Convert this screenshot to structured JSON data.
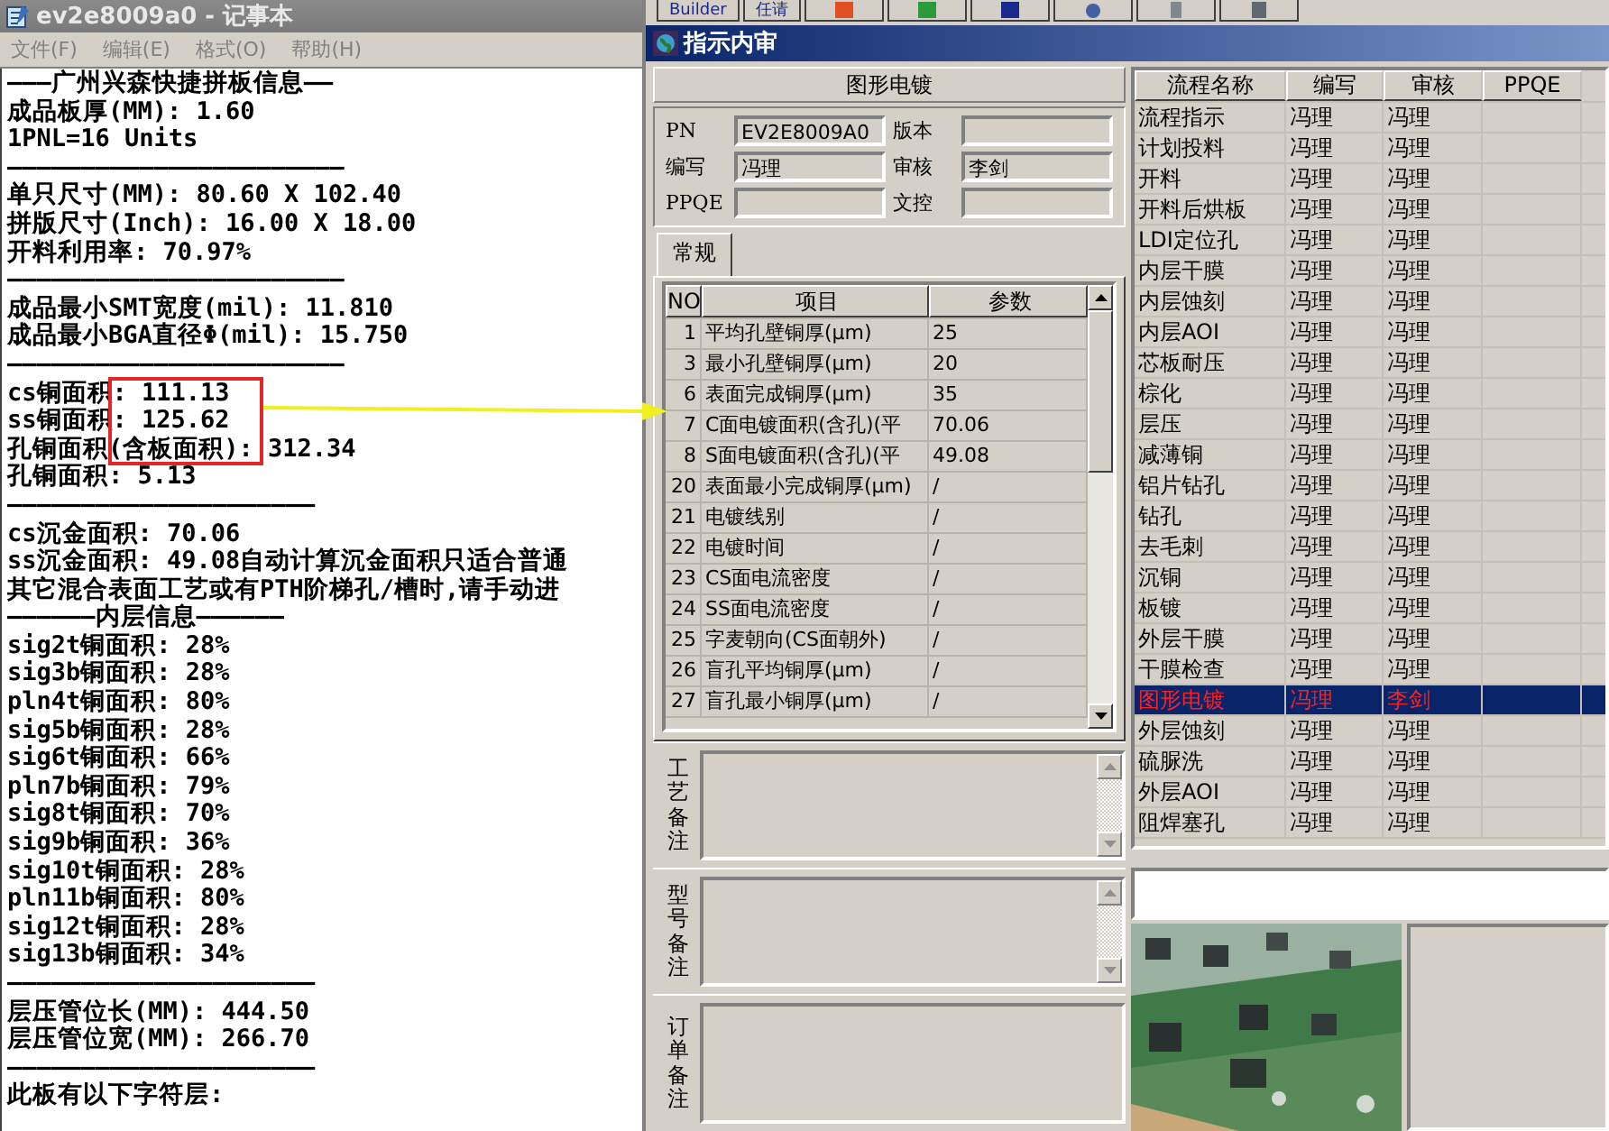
{
  "notepad": {
    "title": "ev2e8009a0 - 记事本",
    "menu": [
      "文件(F)",
      "编辑(E)",
      "格式(O)",
      "帮助(H)"
    ],
    "lines": [
      "———广州兴森快捷拼板信息——",
      "成品板厚(MM): 1.60",
      "1PNL=16 Units",
      "———————————————————————",
      "单只尺寸(MM): 80.60 X 102.40",
      "拼版尺寸(Inch): 16.00 X 18.00",
      "开料利用率: 70.97%",
      "———————————————————————",
      "成品最小SMT宽度(mil): 11.810",
      "成品最小BGA直径Φ(mil):  15.750",
      "———————————————————————",
      "cs铜面积: 111.13",
      "ss铜面积: 125.62",
      "孔铜面积(含板面积): 312.34",
      "孔铜面积: 5.13",
      "—————————————————————",
      "cs沉金面积: 70.06",
      "ss沉金面积: 49.08自动计算沉金面积只适合普通",
      "其它混合表面工艺或有PTH阶梯孔/槽时,请手动进",
      "——————内层信息——————",
      "sig2t铜面积: 28%",
      "sig3b铜面积: 28%",
      "pln4t铜面积: 80%",
      "sig5b铜面积: 28%",
      "sig6t铜面积: 66%",
      "pln7b铜面积: 79%",
      "sig8t铜面积: 70%",
      "sig9b铜面积: 36%",
      "sig10t铜面积: 28%",
      "pln11b铜面积: 80%",
      "sig12t铜面积: 28%",
      "sig13b铜面积: 34%",
      "—————————————————————",
      "层压管位长(MM): 444.50",
      "层压管位宽(MM): 266.70",
      "—————————————————————",
      "此板有以下字符层:"
    ]
  },
  "toolbar": {
    "buttons": [
      "Builder",
      "任请"
    ]
  },
  "window": {
    "title": "指示内审"
  },
  "process_header": "图形电镀",
  "fields": [
    {
      "label": "PN",
      "value": "EV2E8009A0"
    },
    {
      "label": "版本"
    },
    {
      "label": "编写",
      "value": "冯理"
    },
    {
      "label": "审核",
      "value": "李剑"
    },
    {
      "label": "PPQE"
    },
    {
      "label": "文控"
    }
  ],
  "tabs": [
    {
      "label": "常规",
      "selected": true
    }
  ],
  "param_table": {
    "columns": [
      "NO",
      "项目",
      "参数"
    ],
    "rows": [
      [
        "1",
        "平均孔壁铜厚(μm)",
        "25"
      ],
      [
        "3",
        "最小孔壁铜厚(μm)",
        "20"
      ],
      [
        "6",
        "表面完成铜厚(μm)",
        "35"
      ],
      [
        "7",
        "C面电镀面积(含孔)(平",
        "70.06"
      ],
      [
        "8",
        "S面电镀面积(含孔)(平",
        "49.08"
      ],
      [
        "20",
        "表面最小完成铜厚(μm)",
        "/"
      ],
      [
        "21",
        "电镀线别",
        "/"
      ],
      [
        "22",
        "电镀时间",
        "/"
      ],
      [
        "23",
        "CS面电流密度",
        "/"
      ],
      [
        "24",
        "SS面电流密度",
        "/"
      ],
      [
        "25",
        "字麦朝向(CS面朝外)",
        "/"
      ],
      [
        "26",
        "盲孔平均铜厚(μm)",
        "/"
      ],
      [
        "27",
        "盲孔最小铜厚(μm)",
        "/"
      ]
    ]
  },
  "remarks": [
    {
      "label": "工艺备注"
    },
    {
      "label": "型号备注"
    },
    {
      "label": "订单备注"
    }
  ],
  "flow_table": {
    "columns": [
      "流程名称",
      "编写",
      "审核",
      "PPQE"
    ],
    "rows": [
      {
        "cells": [
          "流程指示",
          "冯理",
          "冯理"
        ],
        "selected": false
      },
      {
        "cells": [
          "计划投料",
          "冯理",
          "冯理"
        ],
        "selected": false
      },
      {
        "cells": [
          "开料",
          "冯理",
          "冯理"
        ],
        "selected": false
      },
      {
        "cells": [
          "开料后烘板",
          "冯理",
          "冯理"
        ],
        "selected": false
      },
      {
        "cells": [
          "LDI定位孔",
          "冯理",
          "冯理"
        ],
        "selected": false
      },
      {
        "cells": [
          "内层干膜",
          "冯理",
          "冯理"
        ],
        "selected": false
      },
      {
        "cells": [
          "内层蚀刻",
          "冯理",
          "冯理"
        ],
        "selected": false
      },
      {
        "cells": [
          "内层AOI",
          "冯理",
          "冯理"
        ],
        "selected": false
      },
      {
        "cells": [
          "芯板耐压",
          "冯理",
          "冯理"
        ],
        "selected": false
      },
      {
        "cells": [
          "棕化",
          "冯理",
          "冯理"
        ],
        "selected": false
      },
      {
        "cells": [
          "层压",
          "冯理",
          "冯理"
        ],
        "selected": false
      },
      {
        "cells": [
          "减薄铜",
          "冯理",
          "冯理"
        ],
        "selected": false
      },
      {
        "cells": [
          "铝片钻孔",
          "冯理",
          "冯理"
        ],
        "selected": false
      },
      {
        "cells": [
          "钻孔",
          "冯理",
          "冯理"
        ],
        "selected": false
      },
      {
        "cells": [
          "去毛刺",
          "冯理",
          "冯理"
        ],
        "selected": false
      },
      {
        "cells": [
          "沉铜",
          "冯理",
          "冯理"
        ],
        "selected": false
      },
      {
        "cells": [
          "板镀",
          "冯理",
          "冯理"
        ],
        "selected": false
      },
      {
        "cells": [
          "外层干膜",
          "冯理",
          "冯理"
        ],
        "selected": false
      },
      {
        "cells": [
          "干膜检查",
          "冯理",
          "冯理"
        ],
        "selected": false
      },
      {
        "cells": [
          "图形电镀",
          "冯理",
          "李剑"
        ],
        "selected": true
      },
      {
        "cells": [
          "外层蚀刻",
          "冯理",
          "冯理"
        ],
        "selected": false
      },
      {
        "cells": [
          "硫脲洗",
          "冯理",
          "冯理"
        ],
        "selected": false
      },
      {
        "cells": [
          "外层AOI",
          "冯理",
          "冯理"
        ],
        "selected": false
      },
      {
        "cells": [
          "阻焊塞孔",
          "冯理",
          "冯理"
        ],
        "selected": false
      }
    ]
  }
}
